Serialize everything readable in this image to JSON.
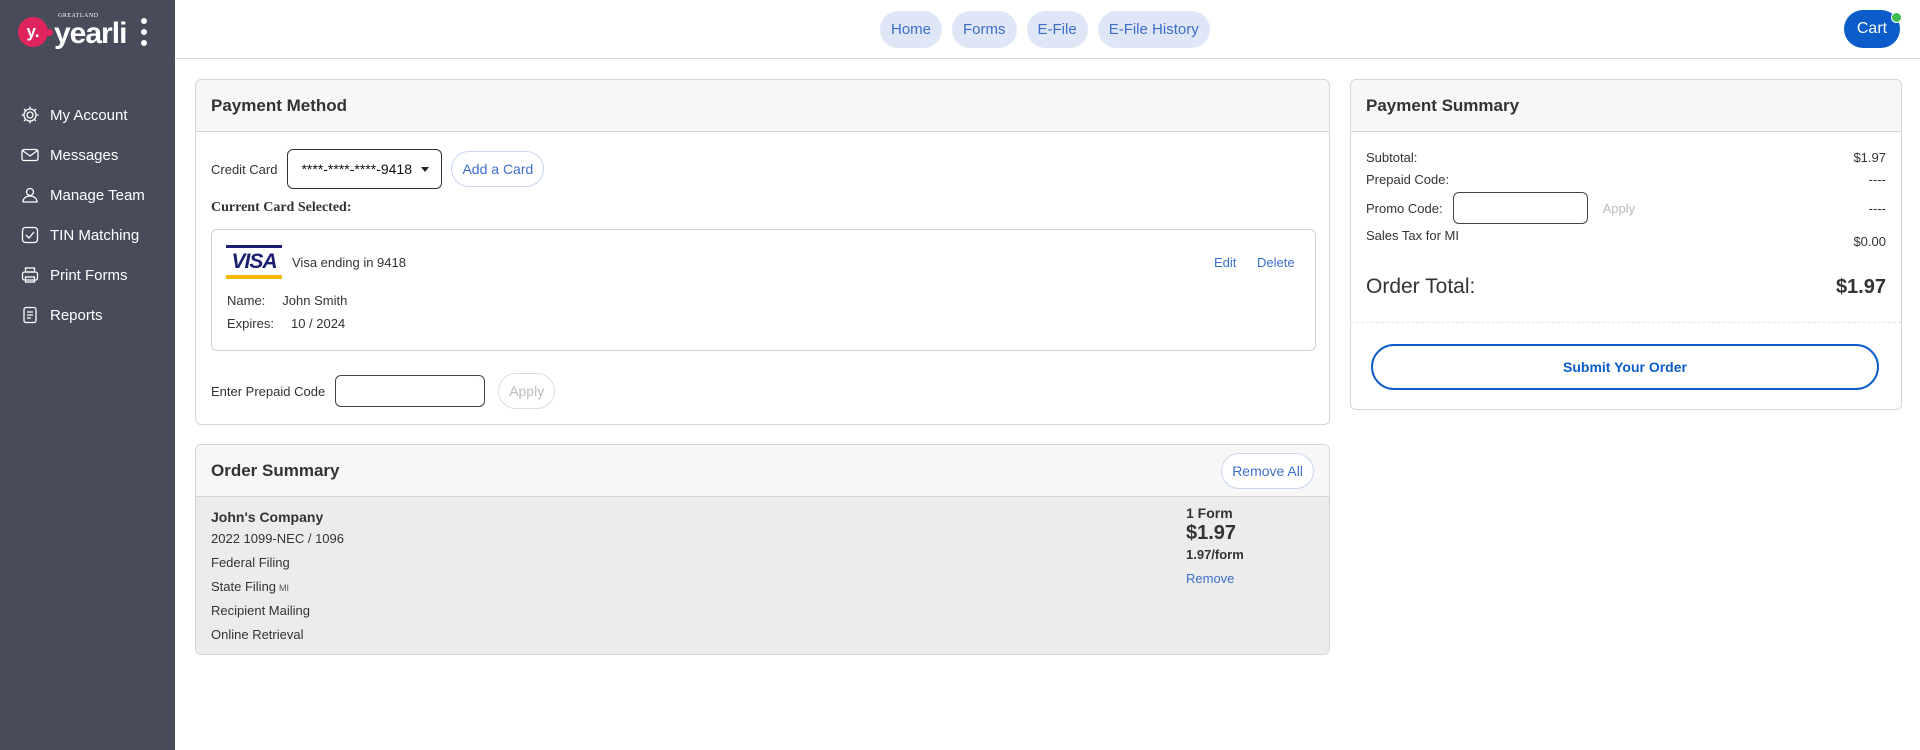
{
  "brand": {
    "small": "GREATLAND",
    "name": "yearli",
    "mark": "y."
  },
  "sidebar": {
    "items": [
      {
        "label": "My Account",
        "icon": "gear-icon"
      },
      {
        "label": "Messages",
        "icon": "envelope-icon"
      },
      {
        "label": "Manage Team",
        "icon": "user-icon"
      },
      {
        "label": "TIN Matching",
        "icon": "check-square-icon"
      },
      {
        "label": "Print Forms",
        "icon": "printer-icon"
      },
      {
        "label": "Reports",
        "icon": "document-icon"
      }
    ]
  },
  "topnav": {
    "items": [
      "Home",
      "Forms",
      "E-File",
      "E-File History"
    ]
  },
  "cart": {
    "label": "Cart"
  },
  "payment_method": {
    "title": "Payment Method",
    "credit_card_label": "Credit Card",
    "selected_card": "****-****-****-9418",
    "add_card": "Add a Card",
    "current_selected_label": "Current Card Selected:",
    "card": {
      "brand": "VISA",
      "ending": "Visa ending in 9418",
      "edit": "Edit",
      "delete": "Delete",
      "name_label": "Name:",
      "name": "John Smith",
      "expires_label": "Expires:",
      "expires": "10 / 2024"
    },
    "prepaid_label": "Enter Prepaid Code",
    "prepaid_value": "",
    "apply": "Apply"
  },
  "order_summary": {
    "title": "Order Summary",
    "remove_all": "Remove All",
    "company": "John's Company",
    "lines": [
      "2022 1099-NEC / 1096",
      "Federal Filing",
      "State Filing",
      "Recipient Mailing",
      "Online Retrieval"
    ],
    "state_code": "MI",
    "forms": "1 Form",
    "price": "$1.97",
    "per_form": "1.97/form",
    "remove": "Remove"
  },
  "payment_summary": {
    "title": "Payment Summary",
    "subtotal_label": "Subtotal:",
    "subtotal": "$1.97",
    "prepaid_label": "Prepaid Code:",
    "prepaid": "----",
    "promo_label": "Promo Code:",
    "promo_value": "",
    "promo_apply": "Apply",
    "promo": "----",
    "tax_label": "Sales Tax for MI",
    "tax": "$0.00",
    "total_label": "Order Total:",
    "total": "$1.97",
    "submit": "Submit Your Order"
  },
  "colors": {
    "sidebar": "#474b5a",
    "accent": "#0b5cc9",
    "link": "#3d6fc9",
    "brand": "#e0245e"
  }
}
